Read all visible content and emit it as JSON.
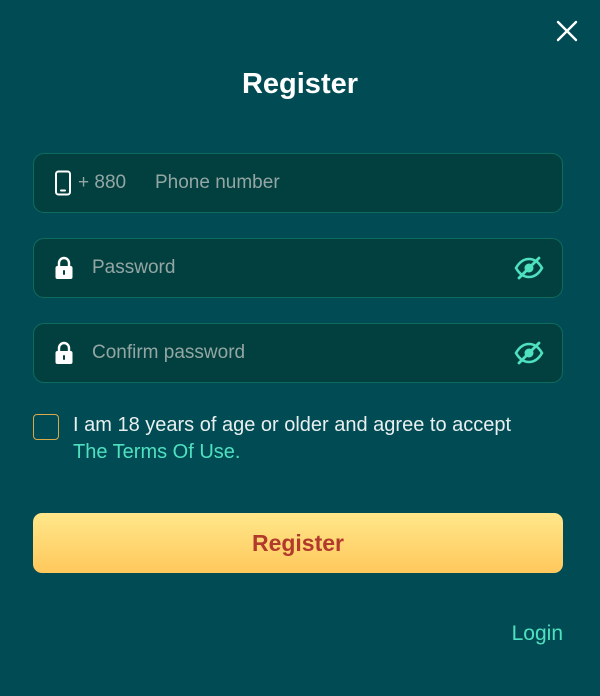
{
  "dialog": {
    "title": "Register"
  },
  "icons": {
    "close": "close-icon",
    "phone": "phone-icon",
    "lock": "lock-icon",
    "eye_off": "eye-off-icon"
  },
  "form": {
    "phone": {
      "prefix": "+ 880",
      "placeholder": "Phone number",
      "value": ""
    },
    "password": {
      "placeholder": "Password",
      "value": ""
    },
    "confirm_password": {
      "placeholder": "Confirm password",
      "value": ""
    },
    "agreement": {
      "text": "I am 18 years of age or older and agree to accept",
      "link_text": "The Terms Of Use.",
      "checked": false
    }
  },
  "actions": {
    "register_label": "Register",
    "login_label": "Login"
  },
  "colors": {
    "background": "#014c54",
    "field_background": "#02403f",
    "accent": "#4fe0c0",
    "button_gradient_top": "#ffe78a",
    "button_gradient_bottom": "#ffc85c",
    "button_text": "#b13a2c",
    "checkbox_border": "#d9a94a"
  }
}
